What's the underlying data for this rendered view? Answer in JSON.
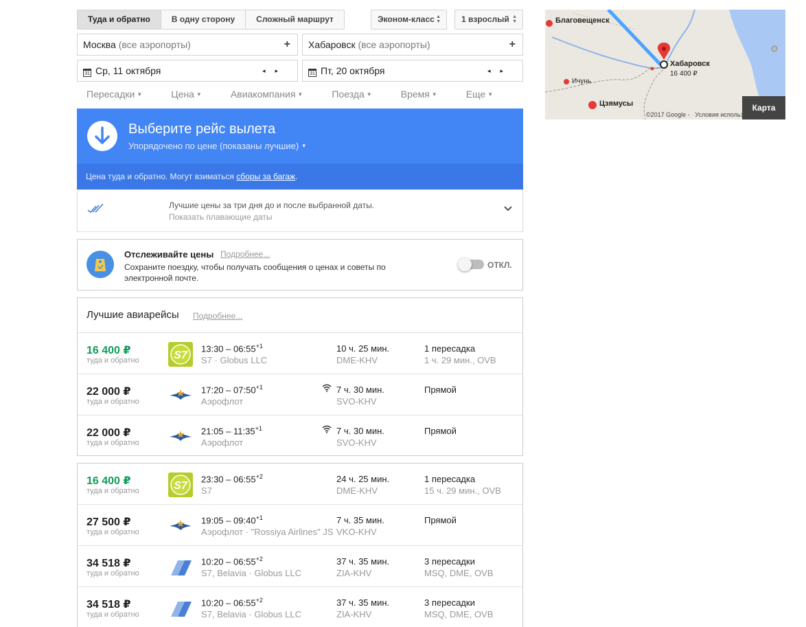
{
  "search": {
    "trip_types": [
      "Туда и обратно",
      "В одну сторону",
      "Сложный маршрут"
    ],
    "cabin": "Эконом-класс",
    "passengers": "1 взрослый",
    "origin": {
      "city": "Москва",
      "hint": "(все аэропорты)"
    },
    "destination": {
      "city": "Хабаровск",
      "hint": "(все аэропорты)"
    },
    "depart_date": "Ср, 11 октября",
    "return_date": "Пт, 20 октября",
    "calendar_glyph": "31",
    "plus": "+",
    "prev": "◂",
    "next": "▸"
  },
  "filters": [
    "Пересадки",
    "Цена",
    "Авиакомпания",
    "Поезда",
    "Время",
    "Еще"
  ],
  "header": {
    "title": "Выберите рейс вылета",
    "subtitle": "Упорядочено по цене (показаны лучшие)",
    "notice_text": "Цена туда и обратно. Могут взиматься",
    "notice_link": "сборы за багаж",
    "notice_end": "."
  },
  "flex_dates": {
    "line1": "Лучшие цены за три дня до и после выбранной даты.",
    "line2": "Показать плавающие даты"
  },
  "tracking": {
    "title": "Отслеживайте цены",
    "more": "Подробнее...",
    "desc": "Сохраните поездку, чтобы получать сообщения о ценах и советы по электронной почте.",
    "toggle": "ОТКЛ."
  },
  "best": {
    "title": "Лучшие авиарейсы",
    "more": "Подробнее...",
    "flights": [
      {
        "price": "16 400 ₽",
        "label": "туда и обратно",
        "dep": "13:30",
        "arr": "06:55",
        "plus": "+1",
        "airline": "S7 · Globus LLC",
        "duration": "10 ч. 25 мин.",
        "route": "DME-KHV",
        "stops": "1 пересадка",
        "via": "1 ч. 29 мин., OVB",
        "logo": "s7"
      },
      {
        "price": "22 000 ₽",
        "label": "туда и обратно",
        "dep": "17:20",
        "arr": "07:50",
        "plus": "+1",
        "airline": "Аэрофлот",
        "duration": "7 ч. 30 мин.",
        "route": "SVO-KHV",
        "stops": "Прямой",
        "via": "",
        "logo": "aeroflot",
        "wifi": true
      },
      {
        "price": "22 000 ₽",
        "label": "туда и обратно",
        "dep": "21:05",
        "arr": "11:35",
        "plus": "+1",
        "airline": "Аэрофлот",
        "duration": "7 ч. 30 мин.",
        "route": "SVO-KHV",
        "stops": "Прямой",
        "via": "",
        "logo": "aeroflot",
        "wifi": true
      }
    ]
  },
  "other": {
    "flights": [
      {
        "price": "16 400 ₽",
        "label": "туда и обратно",
        "dep": "23:30",
        "arr": "06:55",
        "plus": "+2",
        "airline": "S7",
        "duration": "24 ч. 25 мин.",
        "route": "DME-KHV",
        "stops": "1 пересадка",
        "via": "15 ч. 29 мин., OVB",
        "logo": "s7"
      },
      {
        "price": "27 500 ₽",
        "label": "туда и обратно",
        "dep": "19:05",
        "arr": "09:40",
        "plus": "+1",
        "airline": "Аэрофлот · \"Rossiya Airlines\" JSC",
        "duration": "7 ч. 35 мин.",
        "route": "VKO-KHV",
        "stops": "Прямой",
        "via": "",
        "logo": "aeroflot"
      },
      {
        "price": "34 518 ₽",
        "label": "туда и обратно",
        "dep": "10:20",
        "arr": "06:55",
        "plus": "+2",
        "airline": "S7, Belavia · Globus LLC",
        "duration": "37 ч. 35 мин.",
        "route": "ZIA-KHV",
        "stops": "3 пересадки",
        "via": "MSQ, DME, OVB",
        "logo": "multi"
      },
      {
        "price": "34 518 ₽",
        "label": "туда и обратно",
        "dep": "10:20",
        "arr": "06:55",
        "plus": "+2",
        "airline": "S7, Belavia · Globus LLC",
        "duration": "37 ч. 35 мин.",
        "route": "ZIA-KHV",
        "stops": "3 пересадки",
        "via": "MSQ, DME, OVB",
        "logo": "multi"
      }
    ]
  },
  "map": {
    "cities": [
      "Благовещенск",
      "Хабаровск",
      "Ичунь",
      "Цзямусы"
    ],
    "dest_price": "16 400 ₽",
    "button": "Карта",
    "copyright": "©2017 Google -",
    "terms": "Условия использования"
  },
  "colors": {
    "accent": "#4285f4",
    "green": "#0f9d58",
    "s7": "#b5cc2a"
  }
}
